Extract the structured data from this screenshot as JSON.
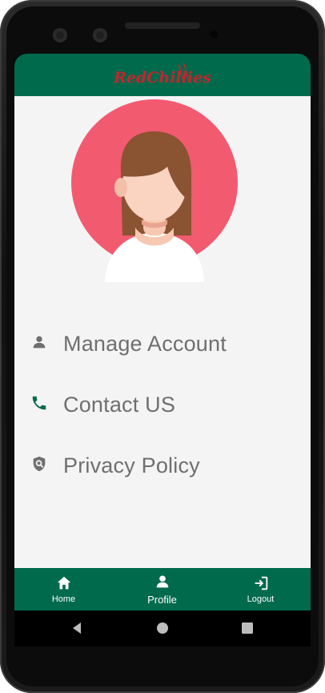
{
  "app": {
    "brand": "RedChillies",
    "brand_color": "#c8232c",
    "accent_color": "#006a4d"
  },
  "profile": {
    "avatar_icon": "female-avatar"
  },
  "menu": [
    {
      "label": "Manage Account",
      "icon": "person-icon",
      "color": "#6f6f6f"
    },
    {
      "label": "Contact US",
      "icon": "phone-icon",
      "color": "#006a4d"
    },
    {
      "label": "Privacy Policy",
      "icon": "shield-search-icon",
      "color": "#6f6f6f"
    }
  ],
  "bottom_nav": [
    {
      "label": "Home",
      "icon": "home-icon"
    },
    {
      "label": "Profile",
      "icon": "person-icon",
      "selected": true
    },
    {
      "label": "Logout",
      "icon": "logout-icon"
    }
  ],
  "system_nav": [
    "back",
    "home",
    "recents"
  ]
}
